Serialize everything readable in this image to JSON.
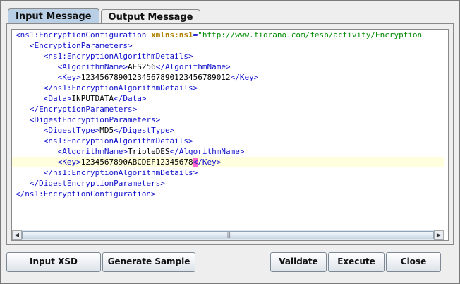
{
  "tabs": [
    {
      "label": "Input Message",
      "active": true
    },
    {
      "label": "Output Message",
      "active": false
    }
  ],
  "editor": {
    "lines": [
      [
        {
          "t": "<ns1:EncryptionConfiguration ",
          "c": "tag"
        },
        {
          "t": "xmlns:ns1",
          "c": "attr"
        },
        {
          "t": "=",
          "c": "tag"
        },
        {
          "t": "\"http://www.fiorano.com/fesb/activity/Encryption",
          "c": "val"
        }
      ],
      [
        {
          "t": "   <EncryptionParameters>",
          "c": "tag"
        }
      ],
      [
        {
          "t": "      <ns1:EncryptionAlgorithmDetails>",
          "c": "tag"
        }
      ],
      [
        {
          "t": "         <AlgorithmName>",
          "c": "tag"
        },
        {
          "t": "AES256",
          "c": "txt"
        },
        {
          "t": "</AlgorithmName>",
          "c": "tag"
        }
      ],
      [
        {
          "t": "         <Key>",
          "c": "tag"
        },
        {
          "t": "12345678901234567890123456789012",
          "c": "txt"
        },
        {
          "t": "</Key>",
          "c": "tag"
        }
      ],
      [
        {
          "t": "      </ns1:EncryptionAlgorithmDetails>",
          "c": "tag"
        }
      ],
      [
        {
          "t": "      <Data>",
          "c": "tag"
        },
        {
          "t": "INPUTDATA",
          "c": "txt"
        },
        {
          "t": "</Data>",
          "c": "tag"
        }
      ],
      [
        {
          "t": "   </EncryptionParameters>",
          "c": "tag"
        }
      ],
      [
        {
          "t": "   <DigestEncryptionParameters>",
          "c": "tag"
        }
      ],
      [
        {
          "t": "      <DigestType>",
          "c": "tag"
        },
        {
          "t": "MD5",
          "c": "txt"
        },
        {
          "t": "</DigestType>",
          "c": "tag"
        }
      ],
      [
        {
          "t": "      <ns1:EncryptionAlgorithmDetails>",
          "c": "tag"
        }
      ],
      [
        {
          "t": "         <AlgorithmName>",
          "c": "tag"
        },
        {
          "t": "TripleDES",
          "c": "txt"
        },
        {
          "t": "</AlgorithmName>",
          "c": "tag"
        }
      ],
      [
        {
          "t": "         <Key>",
          "c": "tag"
        },
        {
          "t": "1234567890ABCDEF12345678",
          "c": "txt"
        },
        {
          "t": "<",
          "c": "caret"
        },
        {
          "t": "/Key>",
          "c": "tag"
        }
      ],
      [
        {
          "t": "      </ns1:EncryptionAlgorithmDetails>",
          "c": "tag"
        }
      ],
      [
        {
          "t": "   </DigestEncryptionParameters>",
          "c": "tag"
        }
      ],
      [
        {
          "t": "</ns1:EncryptionConfiguration>",
          "c": "tag"
        }
      ]
    ],
    "highlighted_line": 12,
    "scroll_left_icon": "arrow-left-icon",
    "scroll_right_icon": "arrow-right-icon",
    "scroll_grip": "|||"
  },
  "buttons": {
    "input_xsd": "Input XSD",
    "generate_sample": "Generate Sample",
    "validate": "Validate",
    "execute": "Execute",
    "close": "Close"
  },
  "colors": {
    "tab_active": "#b8cfe5",
    "tag": "#1010cc",
    "attribute": "#b08000",
    "value": "#008a00",
    "highlight": "#ffffdd",
    "caret": "#ff66cc"
  }
}
